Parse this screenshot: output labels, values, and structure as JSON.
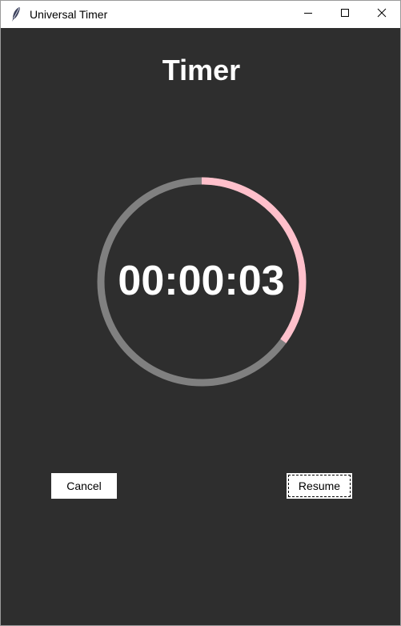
{
  "window": {
    "title": "Universal Timer",
    "icon": "feather-icon",
    "controls": [
      "minimize-icon",
      "maximize-icon",
      "close-icon"
    ]
  },
  "main": {
    "heading": "Timer",
    "time_display": "00:00:03",
    "progress_fraction": 0.35,
    "cancel_label": "Cancel",
    "resume_label": "Resume"
  },
  "colors": {
    "background": "#2e2e2e",
    "ring_track": "#808080",
    "ring_progress": "#ffc0cb",
    "text": "#ffffff",
    "button_bg": "#ffffff"
  }
}
